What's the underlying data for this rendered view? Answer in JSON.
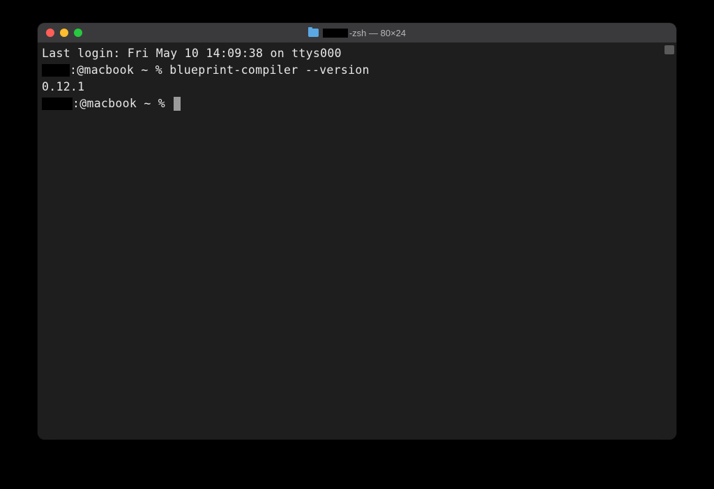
{
  "titlebar": {
    "title_suffix": " -zsh — 80×24"
  },
  "terminal": {
    "line1_prefix": "Last login: Fri May 10 14:09:38 on ttys000",
    "line2_prompt": ":@macbook ~ % ",
    "line2_cmd": "blueprint-compiler --version",
    "line3_output": "0.12.1",
    "line4_prompt": ":@macbook ~ % "
  }
}
